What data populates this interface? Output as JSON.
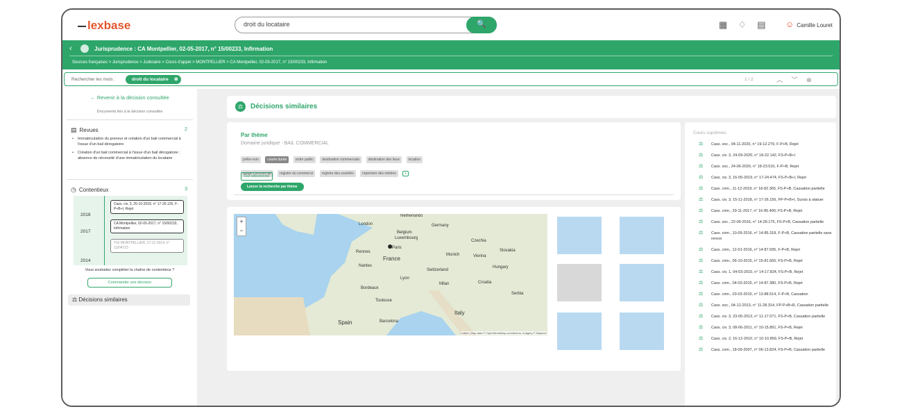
{
  "header": {
    "logo": "lexbase",
    "search_value": "droit du locataire",
    "search_button_glyph": "🔍",
    "user_name": "Camille Louret"
  },
  "doc": {
    "title": "Jurisprudence : CA Montpellier, 02-05-2017, n° 15/00233, Infirmation",
    "breadcrumb": "Sources françaises > Jurisprudence > Judiciaire > Cours d'appel > MONTPELLIER > CA Montpellier, 02-05-2017, n° 15/00233, Infirmation"
  },
  "findbar": {
    "label": "Rechercher les mots :",
    "chip": "droit du locataire",
    "count": "1 / 2"
  },
  "sidebar": {
    "back": "← Revenir à la décision consultée",
    "sub": "Documents liés à la décision consultée",
    "revues": {
      "title": "Revues",
      "count": "2",
      "items": [
        "Immatriculation du preneur et création d'un bail commercial à l'issue d'un bail dérogatoire",
        "Création d'un bail commercial à l'issue d'un bail dérogatoire : absence de nécessité d'une immatriculation du locataire"
      ]
    },
    "contentieux": {
      "title": "Contentieux",
      "count": "3",
      "years": [
        "2018",
        "2017",
        "2014"
      ],
      "cards": [
        "Cass. civ. 3, 25-10-2018, n° 17-26.126, F-P+B+I, Rejet",
        "CA Montpellier, 02-05-2017, n° 15/00233, Infirmation",
        "TGI MONTPELLIER, 27-11-2014, n° 13/04723"
      ]
    },
    "question": "Vous souhaitez compléter la chaîne de contentieux ?",
    "command": "Commander une décision",
    "similar": "Décisions similaires"
  },
  "main": {
    "title": "Décisions similaires",
    "theme": {
      "title": "Par thème",
      "domain": "Domaine juridique - BAIL COMMERCIAL",
      "tags": [
        "prête-nom",
        "courte durée",
        "ordre public",
        "destination commerciale",
        "destination des lieux",
        "location",
        "usage commercial",
        "registre du commerce",
        "registre des sociétés",
        "répertoire des métiers"
      ],
      "selected_tag": "courte durée",
      "plus": "+",
      "select_all": "Tout sélectionner",
      "launch": "Lancer la recherche par thème"
    },
    "map": {
      "zoom_in": "+",
      "zoom_out": "−",
      "labels": [
        "London",
        "Netherlands",
        "Germany",
        "Belgium",
        "Luxembourg",
        "France",
        "Czechia",
        "Slovakia",
        "Hungary",
        "Switzerland",
        "Italy",
        "Spain",
        "Croatia",
        "Serbia",
        "Rennes",
        "Paris",
        "Nantes",
        "Lyon",
        "Munich",
        "Vienna",
        "Bordeaux",
        "Toulouse",
        "Barcelona",
        "Milan"
      ],
      "attribution": "Leaflet | Map data © OpenStreetMap contributors, Imagery © Mapbox"
    }
  },
  "supremes": {
    "title": "Cours suprêmes",
    "items": [
      "Cass. soc., 04-11-2020, n° 19-12.279, F-P+B, Rejet",
      "Cass. civ. 3, 24-09-2020, n° 18-22.142, FS-P+B+I",
      "Cass. soc., 24-06-2020, n° 18-23.510, F-P+B, Rejet",
      "Cass. civ. 3, 16-05-2019, n° 17-24.474, FS-P+B+I, Rejet",
      "Cass. crim., 11-12-2018, n° 18-82.365, FS-P+B, Cassation partielle",
      "Cass. civ. 3, 15-11-2018, n° 17-26.156, FP-P+B+I, Sursis à statuer",
      "Cass. crim., 29-11-2017, n° 16-85.490, FS-P+B, Rejet",
      "Cass. soc., 22-06-2016, n° 14-28.175, FS-P+B, Cassation partielle",
      "Cass. crim., 10-05-2016, n° 14-85.318, F-P+B, Cassation partielle sans renvoi",
      "Cass. crim., 12-01-2016, n° 14-87.695, F-P+B, Rejet",
      "Cass. crim., 06-10-2015, n° 15-81.665, FS-P+B, Rejet",
      "Cass. civ. 1, 04-03-2015, n° 14-17.824, FS-P+B, Rejet",
      "Cass. crim., 04-03-2015, n° 14-87.380, FS-P+B, Rejet",
      "Cass. crim., 03-03-2015, n° 13-88.514, F-P+B, Cassation",
      "Cass. soc., 04-12-2013, n° 11-28.314, FP-P+B+R, Cassation partielle",
      "Cass. civ. 3, 23-05-2013, n° 11-17.071, FS-P+B, Cassation partielle",
      "Cass. civ. 3, 08-06-2011, n° 10-15.891, FS-P+B, Rejet",
      "Cass. civ. 2, 16-12-2010, n° 10-10.859, FS-P+B, Rejet",
      "Cass. com., 18-09-2007, n° 06-13.824, FS-P+B, Cassation partielle"
    ]
  },
  "colors": {
    "brand_green": "#2ea66a",
    "logo_orange": "#e4572e"
  }
}
